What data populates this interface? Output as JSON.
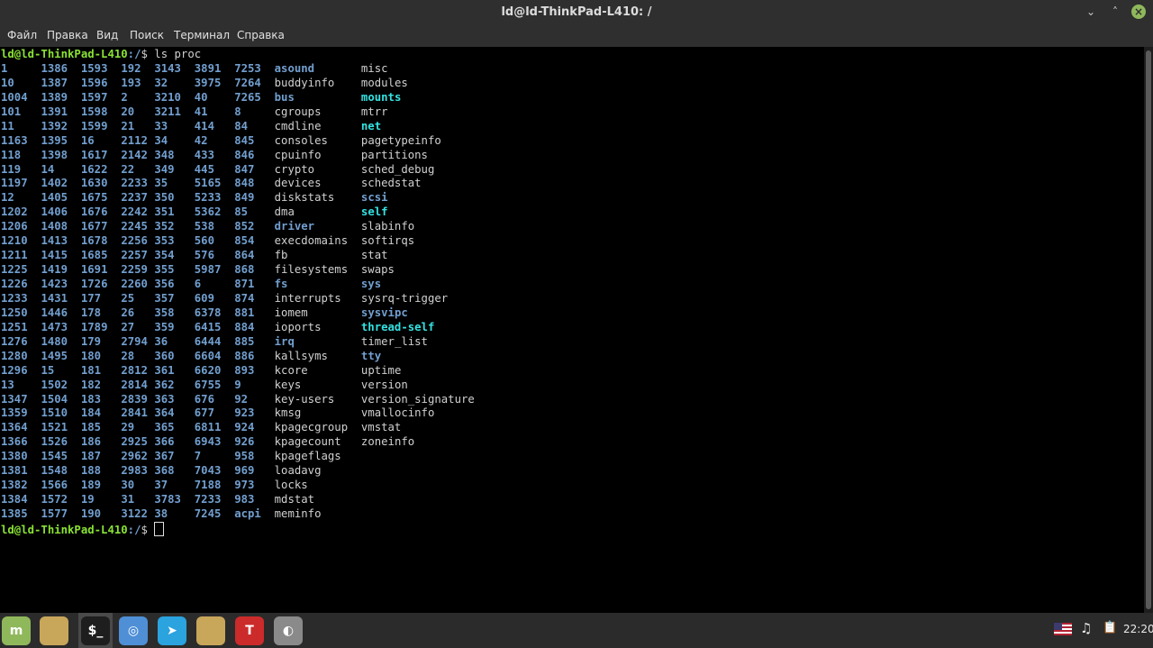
{
  "window": {
    "title": "ld@ld-ThinkPad-L410: /",
    "minimize_icon": "⌄",
    "maximize_icon": "˄",
    "close_icon": "×"
  },
  "menu": {
    "items": [
      "Файл",
      "Правка",
      "Вид",
      "Поиск",
      "Терминал",
      "Справка"
    ]
  },
  "prompt": {
    "user_host": "ld@ld-ThinkPad-L410",
    "path": ":/",
    "symbol": "$ "
  },
  "command": "ls proc",
  "columns": [
    {
      "kind": "pid",
      "items": [
        "1",
        "10",
        "1004",
        "101",
        "11",
        "1163",
        "118",
        "119",
        "1197",
        "12",
        "1202",
        "1206",
        "1210",
        "1211",
        "1225",
        "1226",
        "1233",
        "1250",
        "1251",
        "1276",
        "1280",
        "1296",
        "13",
        "1347",
        "1359",
        "1364",
        "1366",
        "1380",
        "1381",
        "1382",
        "1384",
        "1385"
      ]
    },
    {
      "kind": "pid",
      "items": [
        "1386",
        "1387",
        "1389",
        "1391",
        "1392",
        "1395",
        "1398",
        "14",
        "1402",
        "1405",
        "1406",
        "1408",
        "1413",
        "1415",
        "1419",
        "1423",
        "1431",
        "1446",
        "1473",
        "1480",
        "1495",
        "15",
        "1502",
        "1504",
        "1510",
        "1521",
        "1526",
        "1545",
        "1548",
        "1566",
        "1572",
        "1577"
      ]
    },
    {
      "kind": "pid",
      "items": [
        "1593",
        "1596",
        "1597",
        "1598",
        "1599",
        "16",
        "1617",
        "1622",
        "1630",
        "1675",
        "1676",
        "1677",
        "1678",
        "1685",
        "1691",
        "1726",
        "177",
        "178",
        "1789",
        "179",
        "180",
        "181",
        "182",
        "183",
        "184",
        "185",
        "186",
        "187",
        "188",
        "189",
        "19",
        "190"
      ]
    },
    {
      "kind": "pid",
      "items": [
        "192",
        "193",
        "2",
        "20",
        "21",
        "2112",
        "2142",
        "22",
        "2233",
        "2237",
        "2242",
        "2245",
        "2256",
        "2257",
        "2259",
        "2260",
        "25",
        "26",
        "27",
        "2794",
        "28",
        "2812",
        "2814",
        "2839",
        "2841",
        "29",
        "2925",
        "2962",
        "2983",
        "30",
        "31",
        "3122"
      ]
    },
    {
      "kind": "pid",
      "items": [
        "3143",
        "32",
        "3210",
        "3211",
        "33",
        "34",
        "348",
        "349",
        "35",
        "350",
        "351",
        "352",
        "353",
        "354",
        "355",
        "356",
        "357",
        "358",
        "359",
        "36",
        "360",
        "361",
        "362",
        "363",
        "364",
        "365",
        "366",
        "367",
        "368",
        "37",
        "3783",
        "38"
      ]
    },
    {
      "kind": "pid",
      "items": [
        "3891",
        "3975",
        "40",
        "41",
        "414",
        "42",
        "433",
        "445",
        "5165",
        "5233",
        "5362",
        "538",
        "560",
        "576",
        "5987",
        "6",
        "609",
        "6378",
        "6415",
        "6444",
        "6604",
        "6620",
        "6755",
        "676",
        "677",
        "6811",
        "6943",
        "7",
        "7043",
        "7188",
        "7233",
        "7245"
      ]
    },
    {
      "kind": "pid",
      "items": [
        "7253",
        "7264",
        "7265",
        "8",
        "84",
        "845",
        "846",
        "847",
        "848",
        "849",
        "85",
        "852",
        "854",
        "864",
        "868",
        "871",
        "874",
        "881",
        "884",
        "885",
        "886",
        "893",
        "9",
        "92",
        "923",
        "924",
        "926",
        "958",
        "969",
        "973",
        "983",
        "acpi"
      ]
    },
    {
      "kind": "mixed",
      "items": [
        {
          "t": "asound",
          "k": "dir"
        },
        {
          "t": "buddyinfo",
          "k": "file"
        },
        {
          "t": "bus",
          "k": "dir"
        },
        {
          "t": "cgroups",
          "k": "file"
        },
        {
          "t": "cmdline",
          "k": "file"
        },
        {
          "t": "consoles",
          "k": "file"
        },
        {
          "t": "cpuinfo",
          "k": "file"
        },
        {
          "t": "crypto",
          "k": "file"
        },
        {
          "t": "devices",
          "k": "file"
        },
        {
          "t": "diskstats",
          "k": "file"
        },
        {
          "t": "dma",
          "k": "file"
        },
        {
          "t": "driver",
          "k": "dir"
        },
        {
          "t": "execdomains",
          "k": "file"
        },
        {
          "t": "fb",
          "k": "file"
        },
        {
          "t": "filesystems",
          "k": "file"
        },
        {
          "t": "fs",
          "k": "dir"
        },
        {
          "t": "interrupts",
          "k": "file"
        },
        {
          "t": "iomem",
          "k": "file"
        },
        {
          "t": "ioports",
          "k": "file"
        },
        {
          "t": "irq",
          "k": "dir"
        },
        {
          "t": "kallsyms",
          "k": "file"
        },
        {
          "t": "kcore",
          "k": "file"
        },
        {
          "t": "keys",
          "k": "file"
        },
        {
          "t": "key-users",
          "k": "file"
        },
        {
          "t": "kmsg",
          "k": "file"
        },
        {
          "t": "kpagecgroup",
          "k": "file"
        },
        {
          "t": "kpagecount",
          "k": "file"
        },
        {
          "t": "kpageflags",
          "k": "file"
        },
        {
          "t": "loadavg",
          "k": "file"
        },
        {
          "t": "locks",
          "k": "file"
        },
        {
          "t": "mdstat",
          "k": "file"
        },
        {
          "t": "meminfo",
          "k": "file"
        }
      ]
    },
    {
      "kind": "mixed",
      "items": [
        {
          "t": "misc",
          "k": "file"
        },
        {
          "t": "modules",
          "k": "file"
        },
        {
          "t": "mounts",
          "k": "link"
        },
        {
          "t": "mtrr",
          "k": "file"
        },
        {
          "t": "net",
          "k": "link"
        },
        {
          "t": "pagetypeinfo",
          "k": "file"
        },
        {
          "t": "partitions",
          "k": "file"
        },
        {
          "t": "sched_debug",
          "k": "file"
        },
        {
          "t": "schedstat",
          "k": "file"
        },
        {
          "t": "scsi",
          "k": "dir"
        },
        {
          "t": "self",
          "k": "link"
        },
        {
          "t": "slabinfo",
          "k": "file"
        },
        {
          "t": "softirqs",
          "k": "file"
        },
        {
          "t": "stat",
          "k": "file"
        },
        {
          "t": "swaps",
          "k": "file"
        },
        {
          "t": "sys",
          "k": "dir"
        },
        {
          "t": "sysrq-trigger",
          "k": "file"
        },
        {
          "t": "sysvipc",
          "k": "dir"
        },
        {
          "t": "thread-self",
          "k": "link"
        },
        {
          "t": "timer_list",
          "k": "file"
        },
        {
          "t": "tty",
          "k": "dir"
        },
        {
          "t": "uptime",
          "k": "file"
        },
        {
          "t": "version",
          "k": "file"
        },
        {
          "t": "version_signature",
          "k": "file"
        },
        {
          "t": "vmallocinfo",
          "k": "file"
        },
        {
          "t": "vmstat",
          "k": "file"
        },
        {
          "t": "zoneinfo",
          "k": "file"
        }
      ]
    }
  ],
  "column_widths": [
    6,
    6,
    6,
    5,
    6,
    6,
    6,
    13,
    0
  ],
  "taskbar": {
    "apps": [
      {
        "name": "mint-menu-icon",
        "glyph": "m",
        "color": "#8fb85b"
      },
      {
        "name": "files-folder-icon",
        "glyph": "",
        "color": "#c8a65a"
      },
      {
        "name": "terminal-icon",
        "glyph": "$_",
        "color": "#1e1e1e"
      },
      {
        "name": "chromium-icon",
        "glyph": "◎",
        "color": "#4f8fd6"
      },
      {
        "name": "telegram-icon",
        "glyph": "➤",
        "color": "#2aa3de"
      },
      {
        "name": "folder-icon",
        "glyph": "",
        "color": "#c8a65a"
      },
      {
        "name": "app-red-icon",
        "glyph": "T",
        "color": "#cc2b2b"
      },
      {
        "name": "settings-app-icon",
        "glyph": "◐",
        "color": "#8a8a8a"
      }
    ],
    "tray": {
      "flag_icon": "us-flag-icon",
      "sound_icon": "♫",
      "clipboard_icon": "📋",
      "time": "22:20"
    }
  }
}
